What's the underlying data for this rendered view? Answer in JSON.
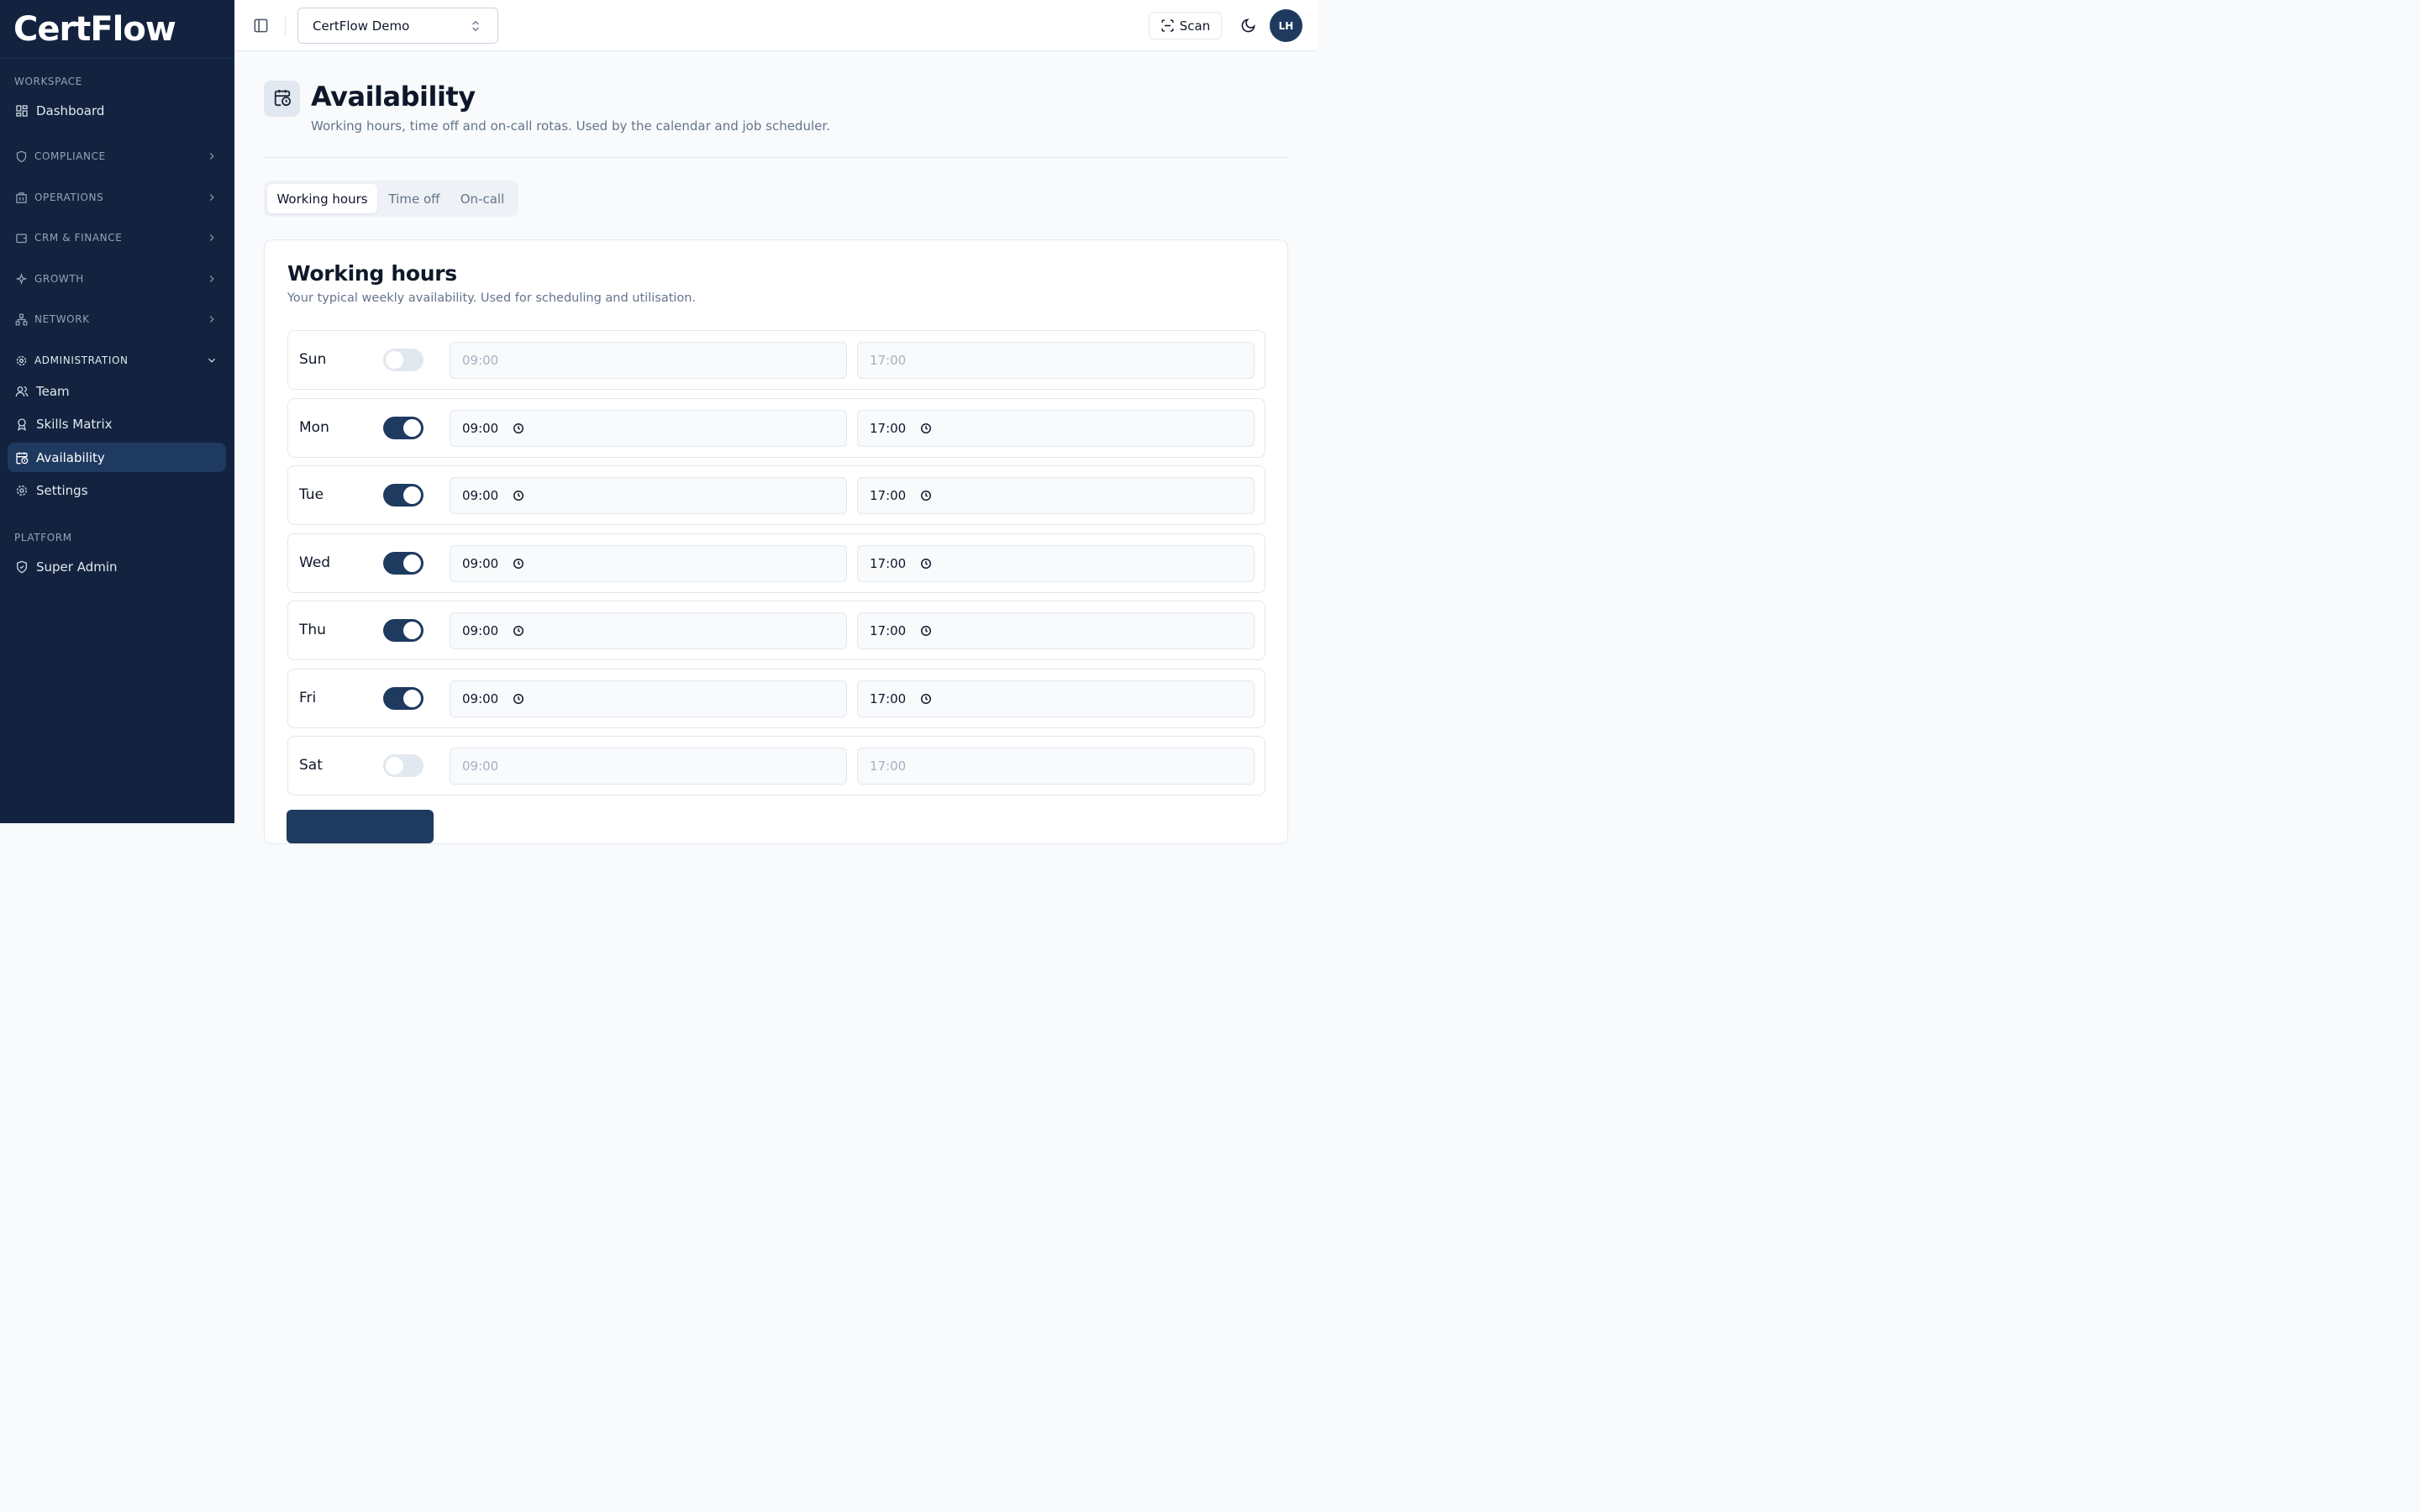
{
  "app": {
    "brand": "CertFlow"
  },
  "sidebar": {
    "workspace_label": "WORKSPACE",
    "dashboard": "Dashboard",
    "groups": {
      "compliance": "COMPLIANCE",
      "operations": "OPERATIONS",
      "crm_finance": "CRM & FINANCE",
      "growth": "GROWTH",
      "network": "NETWORK",
      "administration": "ADMINISTRATION"
    },
    "admin_items": {
      "team": "Team",
      "skills_matrix": "Skills Matrix",
      "availability": "Availability",
      "settings": "Settings"
    },
    "platform_label": "PLATFORM",
    "super_admin": "Super Admin",
    "active_item": "Availability"
  },
  "topbar": {
    "workspace_select": "CertFlow Demo",
    "scan_label": "Scan",
    "avatar_initials": "LH"
  },
  "page": {
    "title": "Availability",
    "subtitle": "Working hours, time off and on-call rotas. Used by the calendar and job scheduler."
  },
  "tabs": {
    "working_hours": "Working hours",
    "time_off": "Time off",
    "on_call": "On-call",
    "active": "Working hours"
  },
  "card": {
    "title": "Working hours",
    "subtitle": "Your typical weekly availability. Used for scheduling and utilisation."
  },
  "days": {
    "sun": {
      "label": "Sun",
      "enabled": false,
      "start": "09:00",
      "end": "17:00"
    },
    "mon": {
      "label": "Mon",
      "enabled": true,
      "start": "09:00",
      "end": "17:00"
    },
    "tue": {
      "label": "Tue",
      "enabled": true,
      "start": "09:00",
      "end": "17:00"
    },
    "wed": {
      "label": "Wed",
      "enabled": true,
      "start": "09:00",
      "end": "17:00"
    },
    "thu": {
      "label": "Thu",
      "enabled": true,
      "start": "09:00",
      "end": "17:00"
    },
    "fri": {
      "label": "Fri",
      "enabled": true,
      "start": "09:00",
      "end": "17:00"
    },
    "sat": {
      "label": "Sat",
      "enabled": false,
      "start": "09:00",
      "end": "17:00"
    }
  },
  "colors": {
    "sidebar_bg": "#13233f",
    "accent": "#1e3a5f",
    "active_nav": "#1f3a60"
  }
}
